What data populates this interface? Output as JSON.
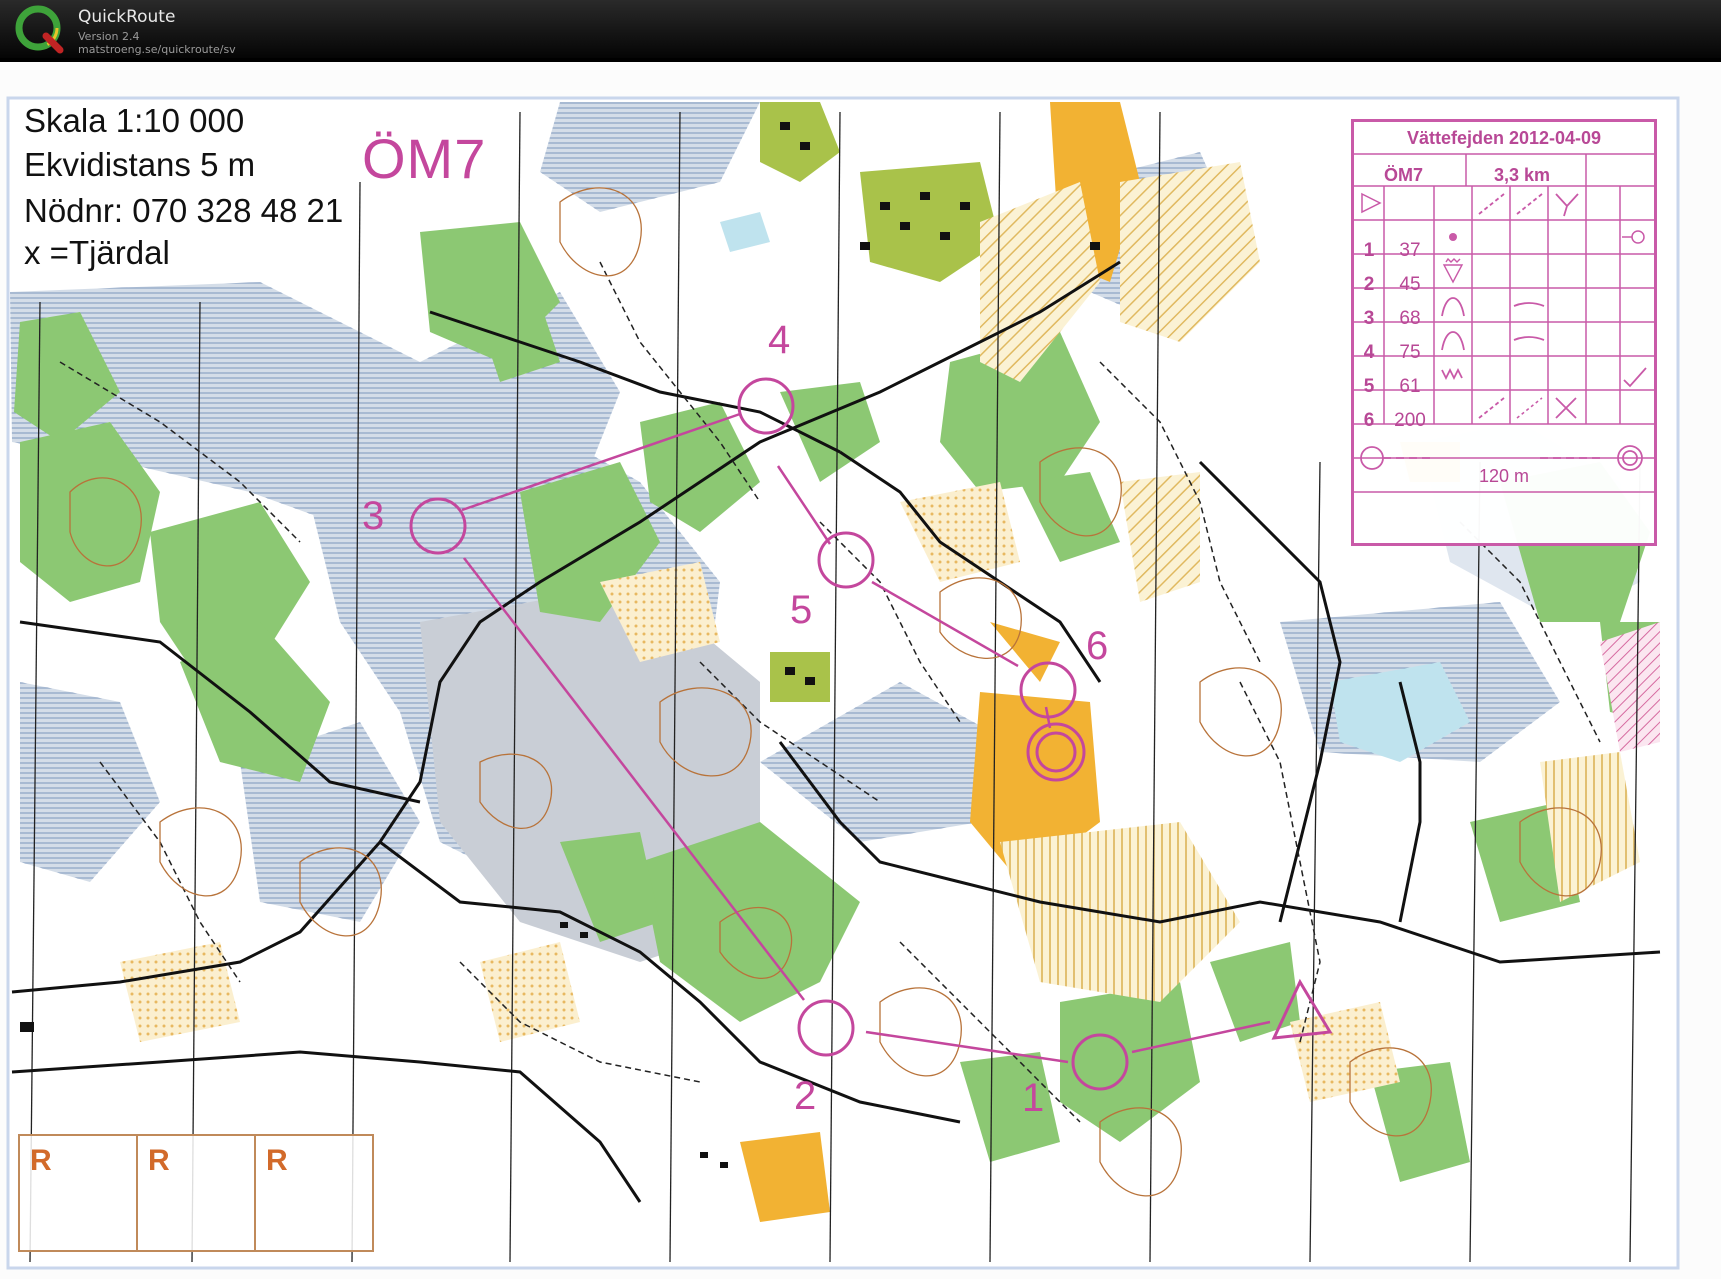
{
  "app": {
    "name": "QuickRoute",
    "version": "Version 2.4",
    "url": "matstroeng.se/quickroute/sv"
  },
  "map": {
    "info_lines": [
      "Skala 1:10 000",
      "Ekvidistans 5 m",
      "Nödnr: 070 328 48 21",
      "x =Tjärdal"
    ],
    "course_name": "ÖM7",
    "control_labels": [
      "1",
      "2",
      "3",
      "4",
      "5",
      "6"
    ],
    "course_color": "#c4479d",
    "r_boxes": [
      "R",
      "R",
      "R"
    ]
  },
  "description": {
    "title": "Vättefejden 2012-04-09",
    "course": "ÖM7",
    "length": "3,3 km",
    "controls": [
      {
        "num": "1",
        "code": "37"
      },
      {
        "num": "2",
        "code": "45"
      },
      {
        "num": "3",
        "code": "68"
      },
      {
        "num": "4",
        "code": "75"
      },
      {
        "num": "5",
        "code": "61"
      },
      {
        "num": "6",
        "code": "200"
      }
    ],
    "finish_distance": "120 m"
  },
  "icons": [
    "quickroute-logo",
    "start-triangle-icon",
    "control-circle-icon",
    "finish-circle-icon"
  ]
}
